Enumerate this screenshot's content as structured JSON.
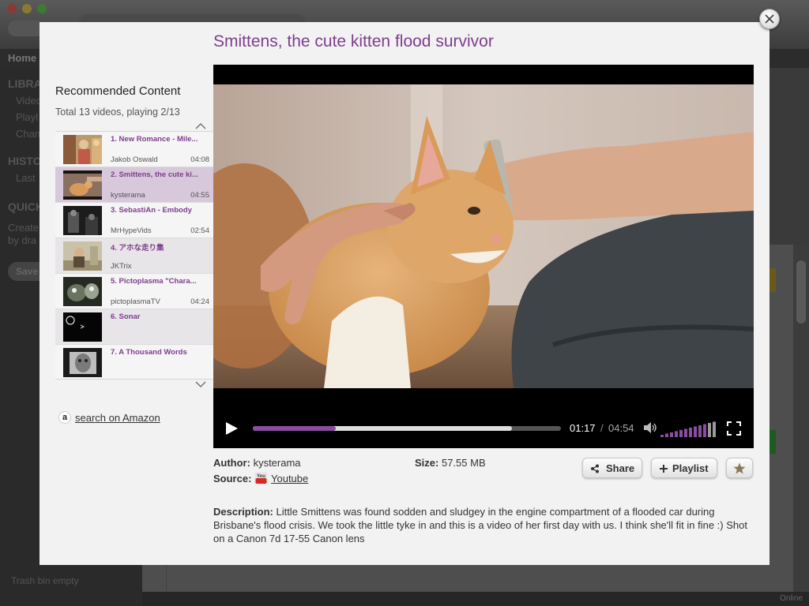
{
  "background": {
    "nav_home": "Home",
    "sidebar": {
      "sections": [
        "LIBRA",
        "HISTO",
        "QUICK"
      ],
      "library_items": [
        "Video",
        "Playl",
        "Chan"
      ],
      "history_items": [
        "Last"
      ],
      "quick_text": [
        "Create",
        "by dra"
      ],
      "save_label": "Save",
      "trash_label": "Trash bin empty"
    },
    "status_text": "Online",
    "colors": {
      "accent_yellow": "#f0c020",
      "accent_green": "#2fae3a"
    }
  },
  "modal": {
    "title": "Smittens, the cute kitten flood survivor",
    "close_icon": "close-icon",
    "recommended": {
      "heading": "Recommended Content",
      "summary": "Total 13 videos, playing 2/13",
      "items": [
        {
          "title": "1. New Romance - Mile...",
          "author": "Jakob Oswald",
          "duration": "04:08",
          "selected": false
        },
        {
          "title": "2. Smittens, the cute ki...",
          "author": "kysterama",
          "duration": "04:55",
          "selected": true
        },
        {
          "title": "3. SebastiAn - Embody",
          "author": "MrHypeVids",
          "duration": "02:54",
          "selected": false
        },
        {
          "title": "4. アホな走り集",
          "author": "JKTrix",
          "duration": "",
          "selected": false
        },
        {
          "title": "5. Pictoplasma \"Chara...",
          "author": "pictoplasmaTV",
          "duration": "04:24",
          "selected": false
        },
        {
          "title": "6. Sonar",
          "author": "",
          "duration": "",
          "selected": false
        },
        {
          "title": "7. A Thousand Words",
          "author": "",
          "duration": "",
          "selected": false
        }
      ],
      "amazon_icon_letter": "a",
      "amazon_link": "search on Amazon"
    },
    "player": {
      "current_time": "01:17",
      "separator": "/",
      "total_time": "04:54",
      "played_fraction": 0.27,
      "buffered_fraction": 0.84,
      "volume_fraction": 0.85,
      "accent_color": "#8a4ea0"
    },
    "info": {
      "author_label": "Author:",
      "author_value": "kysterama",
      "source_label": "Source:",
      "source_value": "Youtube",
      "size_label": "Size:",
      "size_value": "57.55 MB",
      "share_label": "Share",
      "playlist_label": "Playlist",
      "description_label": "Description:",
      "description_text": "Little Smittens was found sodden and sludgey in the engine compartment of a flooded car during Brisbane's flood crisis. We took the little tyke in and this is a video of her first day with us. I think she'll fit in fine :) Shot on a Canon 7d 17-55 Canon lens"
    }
  }
}
